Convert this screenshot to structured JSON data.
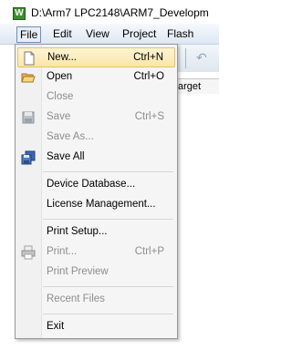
{
  "window": {
    "title": "D:\\Arm7 LPC2148\\ARM7_Developm",
    "app_icon_letter": "W"
  },
  "menubar": {
    "items": [
      {
        "label": "File"
      },
      {
        "label": "Edit"
      },
      {
        "label": "View"
      },
      {
        "label": "Project"
      },
      {
        "label": "Flash"
      }
    ]
  },
  "background": {
    "target_label": "arget"
  },
  "file_menu": {
    "items": [
      {
        "label": "New...",
        "shortcut": "Ctrl+N",
        "enabled": true,
        "highlighted": true,
        "icon": "new-document-icon"
      },
      {
        "label": "Open",
        "shortcut": "Ctrl+O",
        "enabled": true,
        "icon": "open-folder-icon"
      },
      {
        "label": "Close",
        "shortcut": "",
        "enabled": false
      },
      {
        "label": "Save",
        "shortcut": "Ctrl+S",
        "enabled": false,
        "icon": "save-disk-icon"
      },
      {
        "label": "Save As...",
        "shortcut": "",
        "enabled": false
      },
      {
        "label": "Save All",
        "shortcut": "",
        "enabled": true,
        "icon": "save-all-icon"
      },
      {
        "label": "Device Database...",
        "shortcut": "",
        "enabled": true
      },
      {
        "label": "License Management...",
        "shortcut": "",
        "enabled": true
      },
      {
        "label": "Print Setup...",
        "shortcut": "",
        "enabled": true
      },
      {
        "label": "Print...",
        "shortcut": "Ctrl+P",
        "enabled": false,
        "icon": "printer-icon"
      },
      {
        "label": "Print Preview",
        "shortcut": "",
        "enabled": false
      },
      {
        "label": "Recent Files",
        "shortcut": "",
        "enabled": false
      },
      {
        "label": "Exit",
        "shortcut": "",
        "enabled": true
      }
    ]
  },
  "colors": {
    "highlight": "#fbe5a6",
    "disabled_text": "#8d8d8d",
    "app_icon": "#3b8e2e"
  }
}
